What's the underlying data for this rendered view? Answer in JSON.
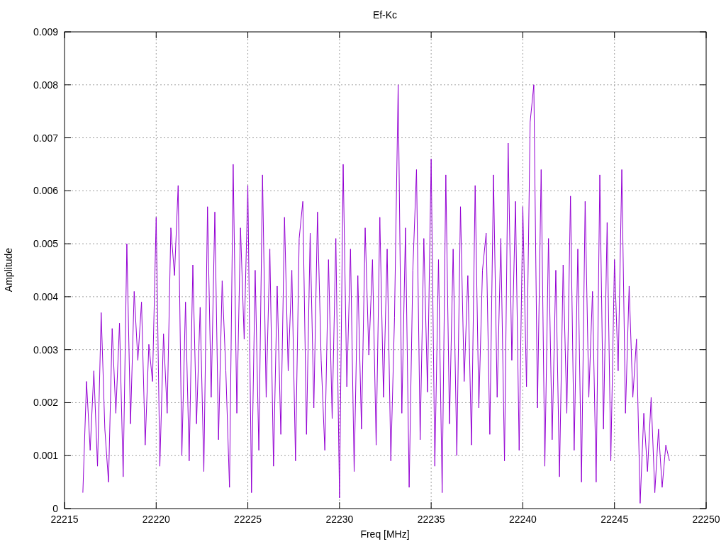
{
  "chart": {
    "chart_data": {
      "type": "line",
      "title": "Ef-Kc",
      "xlabel": "Freq [MHz]",
      "ylabel": "Amplitude",
      "x": [
        22216,
        22216.2,
        22216.4,
        22216.6,
        22216.8,
        22217,
        22217.2,
        22217.4,
        22217.6,
        22217.8,
        22218,
        22218.2,
        22218.4,
        22218.6,
        22218.8,
        22219,
        22219.2,
        22219.4,
        22219.6,
        22219.8,
        22220,
        22220.2,
        22220.4,
        22220.6,
        22220.8,
        22221,
        22221.2,
        22221.4,
        22221.6,
        22221.8,
        22222,
        22222.2,
        22222.4,
        22222.6,
        22222.8,
        22223,
        22223.2,
        22223.4,
        22223.6,
        22223.8,
        22224,
        22224.2,
        22224.4,
        22224.6,
        22224.8,
        22225,
        22225.2,
        22225.4,
        22225.6,
        22225.8,
        22226,
        22226.2,
        22226.4,
        22226.6,
        22226.8,
        22227,
        22227.2,
        22227.4,
        22227.6,
        22227.8,
        22228,
        22228.2,
        22228.4,
        22228.6,
        22228.8,
        22229,
        22229.2,
        22229.4,
        22229.6,
        22229.8,
        22230,
        22230.2,
        22230.4,
        22230.6,
        22230.8,
        22231,
        22231.2,
        22231.4,
        22231.6,
        22231.8,
        22232,
        22232.2,
        22232.4,
        22232.6,
        22232.8,
        22233,
        22233.2,
        22233.4,
        22233.6,
        22233.8,
        22234,
        22234.2,
        22234.4,
        22234.6,
        22234.8,
        22235,
        22235.2,
        22235.4,
        22235.6,
        22235.8,
        22236,
        22236.2,
        22236.4,
        22236.6,
        22236.8,
        22237,
        22237.2,
        22237.4,
        22237.6,
        22237.8,
        22238,
        22238.2,
        22238.4,
        22238.6,
        22238.8,
        22239,
        22239.2,
        22239.4,
        22239.6,
        22239.8,
        22240,
        22240.2,
        22240.4,
        22240.6,
        22240.8,
        22241,
        22241.2,
        22241.4,
        22241.6,
        22241.8,
        22242,
        22242.2,
        22242.4,
        22242.6,
        22242.8,
        22243,
        22243.2,
        22243.4,
        22243.6,
        22243.8,
        22244,
        22244.2,
        22244.4,
        22244.6,
        22244.8,
        22245,
        22245.2,
        22245.4,
        22245.6,
        22245.8,
        22246,
        22246.2,
        22246.4,
        22246.6,
        22246.8,
        22247,
        22247.2,
        22247.4,
        22247.6,
        22247.8,
        22248
      ],
      "grid": true,
      "series": [
        {
          "color": "#9400d3",
          "values": [
            0.0003,
            0.0024,
            0.0011,
            0.0026,
            0.0008,
            0.0037,
            0.0015,
            0.0005,
            0.0034,
            0.0018,
            0.0035,
            0.0006,
            0.005,
            0.0016,
            0.0041,
            0.0028,
            0.0039,
            0.0012,
            0.0031,
            0.0024,
            0.0055,
            0.0008,
            0.0033,
            0.0018,
            0.0053,
            0.0044,
            0.0061,
            0.001,
            0.0039,
            0.0009,
            0.0046,
            0.0016,
            0.0038,
            0.0007,
            0.0057,
            0.0021,
            0.0056,
            0.0013,
            0.0043,
            0.0026,
            0.0004,
            0.0065,
            0.0018,
            0.0053,
            0.0032,
            0.0061,
            0.0003,
            0.0045,
            0.0011,
            0.0063,
            0.0021,
            0.0049,
            0.0008,
            0.0042,
            0.0014,
            0.0055,
            0.0026,
            0.0045,
            0.0009,
            0.0051,
            0.0058,
            0.0014,
            0.0052,
            0.0019,
            0.0056,
            0.0028,
            0.0011,
            0.0047,
            0.0017,
            0.0051,
            0.0002,
            0.0065,
            0.0023,
            0.0049,
            0.0007,
            0.0044,
            0.0015,
            0.0053,
            0.0029,
            0.0047,
            0.0012,
            0.0055,
            0.0021,
            0.0049,
            0.0009,
            0.0036,
            0.008,
            0.0018,
            0.0053,
            0.0004,
            0.0045,
            0.0064,
            0.0013,
            0.0051,
            0.0022,
            0.0066,
            0.0008,
            0.0047,
            0.0003,
            0.0063,
            0.0016,
            0.0049,
            0.001,
            0.0057,
            0.0024,
            0.0044,
            0.0012,
            0.0061,
            0.0019,
            0.0045,
            0.0052,
            0.0014,
            0.0063,
            0.0021,
            0.0051,
            0.0009,
            0.0069,
            0.0028,
            0.0058,
            0.0011,
            0.0057,
            0.0023,
            0.0073,
            0.008,
            0.0019,
            0.0064,
            0.0008,
            0.0051,
            0.0013,
            0.0045,
            0.0006,
            0.0046,
            0.0018,
            0.0059,
            0.0011,
            0.0049,
            0.0005,
            0.0058,
            0.0021,
            0.0041,
            0.0005,
            0.0063,
            0.0015,
            0.0054,
            0.0009,
            0.0047,
            0.0026,
            0.0064,
            0.0018,
            0.0042,
            0.0021,
            0.0032,
            0.0001,
            0.0018,
            0.0007,
            0.0021,
            0.0003,
            0.0015,
            0.0004,
            0.0012,
            0.0009
          ]
        }
      ],
      "xlim": [
        22215,
        22250
      ],
      "ylim": [
        0,
        0.009
      ],
      "xticks": [
        22215,
        22220,
        22225,
        22230,
        22235,
        22240,
        22245,
        22250
      ],
      "yticks": [
        0.009,
        0.008,
        0.007,
        0.006,
        0.005,
        0.004,
        0.003,
        0.002,
        0.001,
        0
      ]
    }
  }
}
